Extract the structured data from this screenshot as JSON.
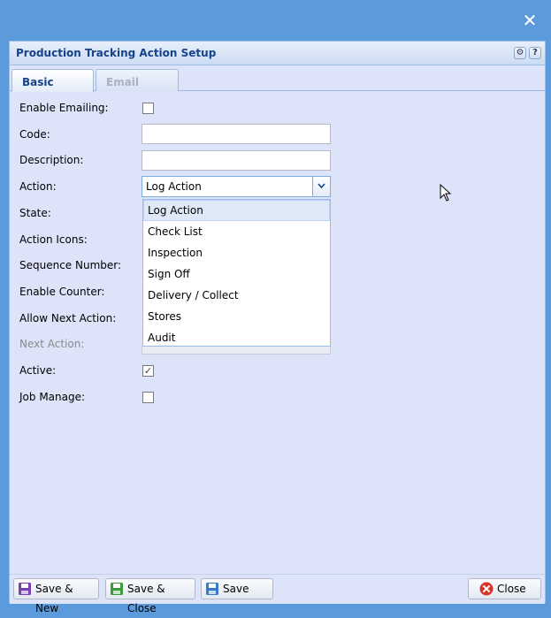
{
  "window": {
    "close_glyph": "✕"
  },
  "dialog": {
    "title": "Production Tracking Action Setup",
    "tools": {
      "gear_glyph": "⚙",
      "help_glyph": "?"
    }
  },
  "tabs": [
    {
      "label": "Basic",
      "active": true
    },
    {
      "label": "Email",
      "active": false
    }
  ],
  "form": {
    "enable_emailing": {
      "label": "Enable Emailing:",
      "checked": false
    },
    "code": {
      "label": "Code:",
      "value": ""
    },
    "description": {
      "label": "Description:",
      "value": ""
    },
    "action": {
      "label": "Action:",
      "value": "Log Action"
    },
    "state": {
      "label": "State:"
    },
    "action_icons": {
      "label": "Action Icons:"
    },
    "sequence_number": {
      "label": "Sequence Number:"
    },
    "enable_counter": {
      "label": "Enable Counter:"
    },
    "allow_next_action": {
      "label": "Allow Next Action:"
    },
    "next_action": {
      "label": "Next Action:"
    },
    "active": {
      "label": "Active:",
      "checked": true,
      "check_glyph": "✓"
    },
    "job_manage": {
      "label": "Job Manage:",
      "checked": false
    }
  },
  "action_dropdown": {
    "options": [
      "Log Action",
      "Check List",
      "Inspection",
      "Sign Off",
      "Delivery / Collect",
      "Stores",
      "Audit"
    ],
    "selected": "Log Action"
  },
  "footer": {
    "save_new_label": "Save & New",
    "save_close_label": "Save & Close",
    "save_label": "Save",
    "close_label": "Close"
  },
  "colors": {
    "background": "#5b9bdc",
    "panel": "#dde3f8",
    "title": "#15428b",
    "save_icon_purple": "#7a3fb0",
    "save_icon_green": "#3c9a3c",
    "save_icon_blue": "#3a78c9",
    "close_icon_red": "#d9342b"
  }
}
